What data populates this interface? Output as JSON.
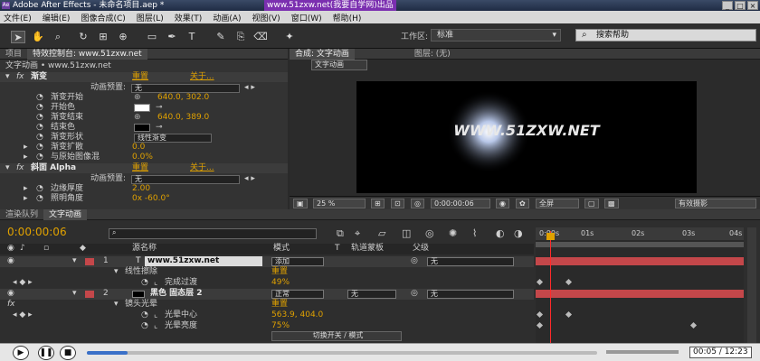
{
  "title": {
    "text": "Adobe After Effects - 未命名项目.aep *",
    "watermark": "www.51zxw.net(我要自学网)出品"
  },
  "menu": [
    "文件(E)",
    "编辑(E)",
    "图像合成(C)",
    "图层(L)",
    "效果(T)",
    "动画(A)",
    "视图(V)",
    "窗口(W)",
    "帮助(H)"
  ],
  "toolbar": {
    "workspace_label": "工作区:",
    "workspace_value": "标准",
    "search_placeholder": "搜索帮助"
  },
  "left_panel": {
    "tabs": [
      "项目",
      "特效控制台: www.51zxw.net",
      "关于..."
    ],
    "breadcrumb": "文字动画 • www.51zxw.net",
    "effect1": {
      "name": "渐变",
      "reset": "重置",
      "about": "关于...",
      "preset_label": "动画预置:",
      "preset_value": "无"
    },
    "props": [
      {
        "label": "渐变开始",
        "value": "640.0, 302.0"
      },
      {
        "label": "开始色",
        "value": ""
      },
      {
        "label": "渐变结束",
        "value": "640.0, 389.0"
      },
      {
        "label": "结束色",
        "value": ""
      },
      {
        "label": "渐变形状",
        "value": "线性渐变"
      },
      {
        "label": "渐变扩散",
        "value": "0.0"
      },
      {
        "label": "与原始图像混",
        "value": "0.0%"
      }
    ],
    "effect2": {
      "name": "斜面 Alpha",
      "reset": "重置",
      "about": "关于...",
      "preset_label": "动画预置:",
      "preset_value": "无"
    },
    "props2": [
      {
        "label": "边缘厚度",
        "value": "2.00"
      },
      {
        "label": "照明角度",
        "value": "0x -60.0°"
      }
    ]
  },
  "comp_panel": {
    "tab": "合成: 文字动画",
    "layer_tab": "图层: (无)",
    "comp_name": "文字动画",
    "viewer_text": "WWW.51ZXW.NET",
    "zoom": "25 %",
    "time": "0:00:00:06",
    "res": "全屏",
    "more": "有效摄影"
  },
  "timeline": {
    "tabs": [
      "渲染队列",
      "文字动画"
    ],
    "timecode": "0:00:00:06",
    "headers": {
      "source": "源名称",
      "mode": "模式",
      "trk": "T",
      "track": "轨道蒙板",
      "parent": "父级"
    },
    "ruler": [
      "0:00s",
      "01s",
      "02s",
      "03s",
      "04s"
    ],
    "layers": [
      {
        "num": "1",
        "name": "www.51zxw.net",
        "mode": "添加",
        "parent": "无"
      },
      {
        "sub": "线性擦除",
        "reset": "重置"
      },
      {
        "sub": "完成过渡",
        "value": "49%"
      },
      {
        "num": "2",
        "name": "黑色 固态层 2",
        "mode": "正常",
        "track": "无",
        "parent": "无"
      },
      {
        "sub": "镜头光晕",
        "reset": "重置"
      },
      {
        "sub": "光晕中心",
        "value": "563.9, 404.0"
      },
      {
        "sub": "光晕亮度",
        "value": "75%"
      }
    ],
    "switch_label": "切换开关 / 模式"
  },
  "player": {
    "time": "00:05 / 12:23",
    "progress": 0.08
  },
  "colors": {
    "accent": "#e0a100",
    "layer_bar": "#c4474a",
    "playhead": "#ff2a2a"
  }
}
